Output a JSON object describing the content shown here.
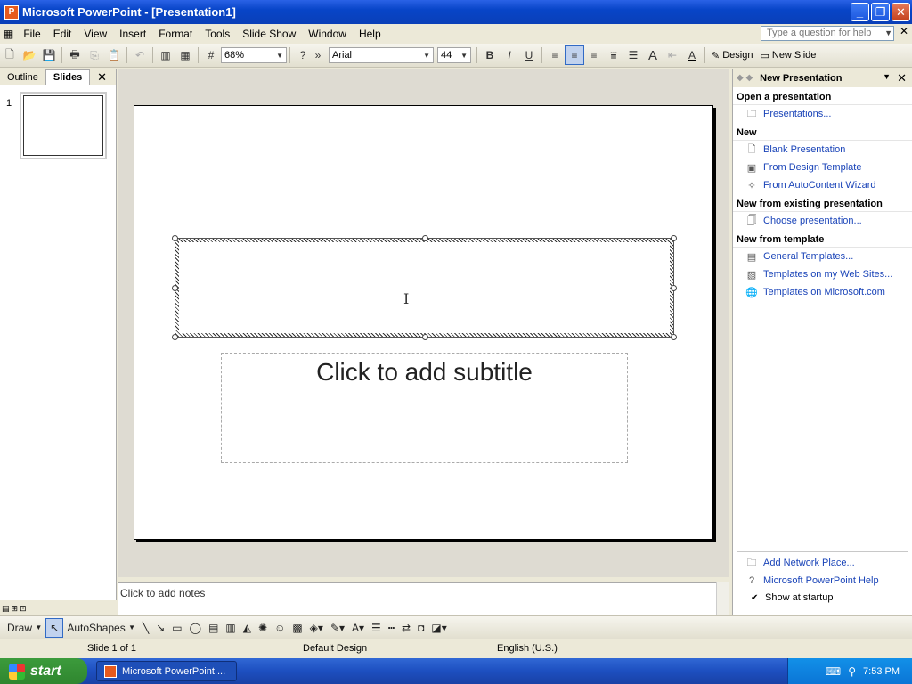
{
  "window": {
    "title": "Microsoft PowerPoint - [Presentation1]",
    "app_icon": "powerpoint-icon"
  },
  "menu": [
    "File",
    "Edit",
    "View",
    "Insert",
    "Format",
    "Tools",
    "Slide Show",
    "Window",
    "Help"
  ],
  "ask": {
    "placeholder": "Type a question for help"
  },
  "toolbar": {
    "zoom": "68%",
    "font": "Arial",
    "size": "44",
    "design_label": "Design",
    "newslide_label": "New Slide"
  },
  "left_pane": {
    "tabs": [
      "Outline",
      "Slides"
    ],
    "active": "Slides",
    "thumb_number": "1"
  },
  "slide": {
    "subtitle_placeholder": "Click to add subtitle"
  },
  "notes": {
    "placeholder": "Click to add notes"
  },
  "task_pane": {
    "title": "New Presentation",
    "sections": [
      {
        "heading": "Open a presentation",
        "links": [
          {
            "label": "Presentations...",
            "icon": "folder-icon"
          }
        ]
      },
      {
        "heading": "New",
        "links": [
          {
            "label": "Blank Presentation",
            "icon": "blank-doc-icon"
          },
          {
            "label": "From Design Template",
            "icon": "design-template-icon"
          },
          {
            "label": "From AutoContent Wizard",
            "icon": "wizard-icon"
          }
        ]
      },
      {
        "heading": "New from existing presentation",
        "links": [
          {
            "label": "Choose presentation...",
            "icon": "existing-doc-icon"
          }
        ]
      },
      {
        "heading": "New from template",
        "links": [
          {
            "label": "General Templates...",
            "icon": "template-icon"
          },
          {
            "label": "Templates on my Web Sites...",
            "icon": "web-template-icon"
          },
          {
            "label": "Templates on Microsoft.com",
            "icon": "globe-icon"
          }
        ]
      }
    ],
    "bottom_links": [
      {
        "label": "Add Network Place...",
        "icon": "network-folder-icon"
      },
      {
        "label": "Microsoft PowerPoint Help",
        "icon": "help-icon"
      }
    ],
    "show_at_startup": {
      "label": "Show at startup",
      "checked": true
    }
  },
  "drawbar": {
    "draw_label": "Draw",
    "autoshapes_label": "AutoShapes"
  },
  "status": {
    "slide": "Slide 1 of 1",
    "design": "Default Design",
    "language": "English (U.S.)"
  },
  "taskbar": {
    "start": "start",
    "item": "Microsoft PowerPoint ...",
    "time": "7:53 PM"
  }
}
